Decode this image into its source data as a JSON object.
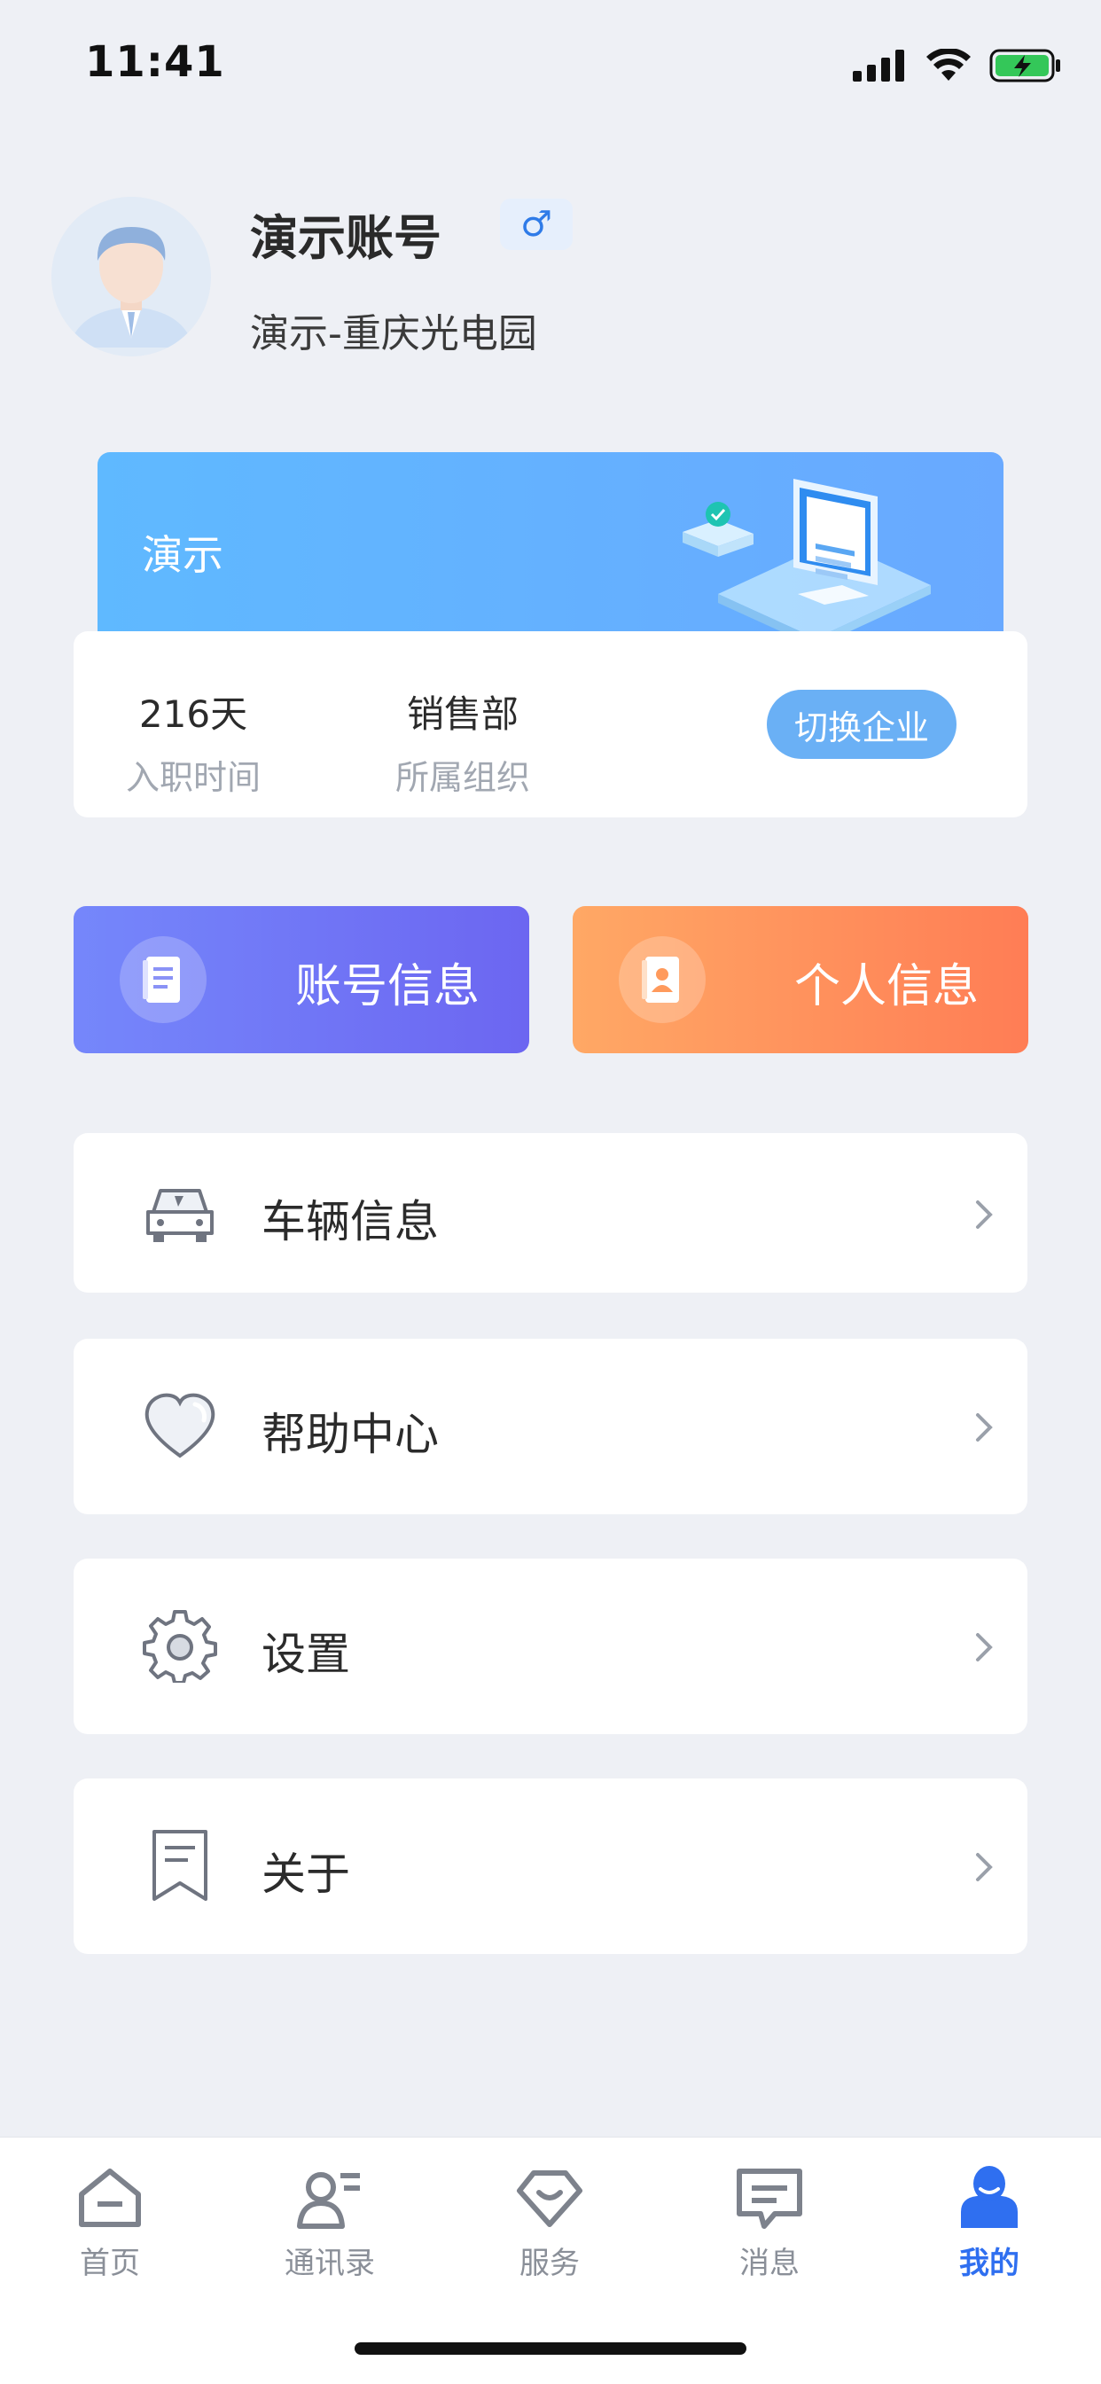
{
  "status_bar": {
    "time": "11:41"
  },
  "profile": {
    "name": "演示账号",
    "gender_symbol": "♂",
    "organization": "演示-重庆光电园"
  },
  "company": {
    "banner_title": "演示",
    "tenure_value": "216天",
    "tenure_label": "入职时间",
    "dept_value": "销售部",
    "dept_label": "所属组织",
    "switch_label": "切换企业"
  },
  "actions": {
    "account_info": "账号信息",
    "personal_info": "个人信息"
  },
  "menu": [
    {
      "label": "车辆信息",
      "icon": "car-icon"
    },
    {
      "label": "帮助中心",
      "icon": "heart-icon"
    },
    {
      "label": "设置",
      "icon": "gear-icon"
    },
    {
      "label": "关于",
      "icon": "bookmark-icon"
    }
  ],
  "tabs": [
    {
      "label": "首页",
      "icon": "home-icon"
    },
    {
      "label": "通讯录",
      "icon": "contacts-icon"
    },
    {
      "label": "服务",
      "icon": "service-icon"
    },
    {
      "label": "消息",
      "icon": "message-icon"
    },
    {
      "label": "我的",
      "icon": "profile-icon",
      "active": true
    }
  ],
  "colors": {
    "accent": "#2f6ff0",
    "background": "#eef0f5",
    "account_card": "#7080f8",
    "personal_card": "#ff9160",
    "switch_button": "#6ab0f5"
  }
}
